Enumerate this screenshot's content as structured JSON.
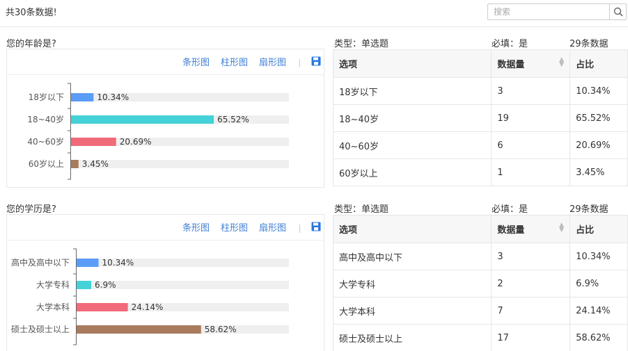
{
  "header": {
    "total_label": "共30条数据!",
    "search_placeholder": "搜索"
  },
  "colors": {
    "link": "#3e7fd6",
    "bar_track": "#efefef",
    "bars": [
      "#5b9cf6",
      "#44d2d8",
      "#f06a7a",
      "#a97b5d"
    ]
  },
  "questions": [
    {
      "title": "您的年龄是?",
      "toolbar": [
        "条形图",
        "柱形图",
        "扇形图"
      ],
      "type_label": "类型：单选题",
      "required_label": "必填：是",
      "count_label": "29条数据",
      "columns": [
        "选项",
        "数据量",
        "占比"
      ],
      "rows": [
        {
          "option": "18岁以下",
          "count": "3",
          "percent": "10.34%"
        },
        {
          "option": "18~40岁",
          "count": "19",
          "percent": "65.52%"
        },
        {
          "option": "40~60岁",
          "count": "6",
          "percent": "20.69%"
        },
        {
          "option": "60岁以上",
          "count": "1",
          "percent": "3.45%"
        }
      ]
    },
    {
      "title": "您的学历是?",
      "toolbar": [
        "条形图",
        "柱形图",
        "扇形图"
      ],
      "type_label": "类型：单选题",
      "required_label": "必填：是",
      "count_label": "29条数据",
      "columns": [
        "选项",
        "数据量",
        "占比"
      ],
      "rows": [
        {
          "option": "高中及高中以下",
          "count": "3",
          "percent": "10.34%"
        },
        {
          "option": "大学专科",
          "count": "2",
          "percent": "6.9%"
        },
        {
          "option": "大学本科",
          "count": "7",
          "percent": "24.14%"
        },
        {
          "option": "硕士及硕士以上",
          "count": "17",
          "percent": "58.62%"
        }
      ]
    }
  ],
  "chart_data": [
    {
      "type": "bar",
      "orientation": "horizontal",
      "categories": [
        "18岁以下",
        "18~40岁",
        "40~60岁",
        "60岁以上"
      ],
      "values": [
        10.34,
        65.52,
        20.69,
        3.45
      ],
      "data_labels": [
        "10.34%",
        "65.52%",
        "20.69%",
        "3.45%"
      ],
      "xlim": [
        0,
        100
      ],
      "grid": false
    },
    {
      "type": "bar",
      "orientation": "horizontal",
      "categories": [
        "高中及高中以下",
        "大学专科",
        "大学本科",
        "硕士及硕士以上"
      ],
      "values": [
        10.34,
        6.9,
        24.14,
        58.62
      ],
      "data_labels": [
        "10.34%",
        "6.9%",
        "24.14%",
        "58.62%"
      ],
      "xlim": [
        0,
        100
      ],
      "grid": false
    }
  ]
}
